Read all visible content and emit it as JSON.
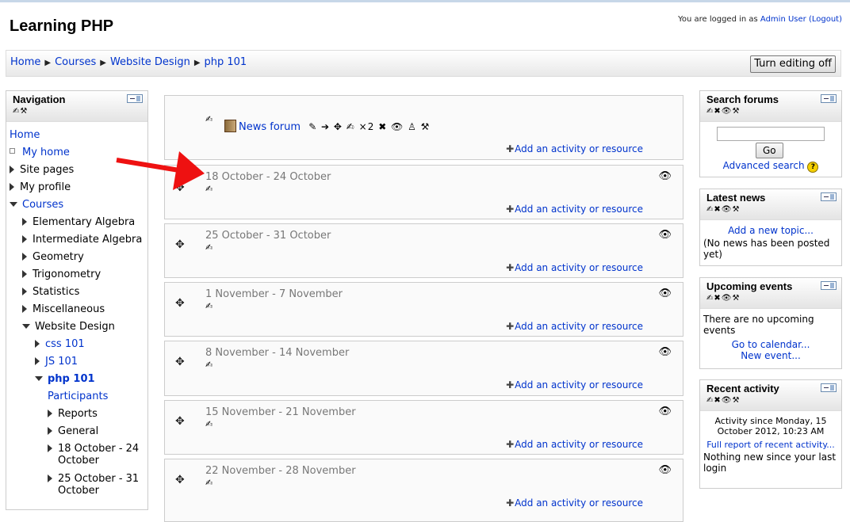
{
  "page": {
    "title": "Learning PHP"
  },
  "login": {
    "prefix": "You are logged in as",
    "user": "Admin User",
    "logout": "(Logout)"
  },
  "breadcrumb": {
    "items": [
      "Home",
      "Courses",
      "Website Design",
      "php 101"
    ],
    "separator": "▶"
  },
  "edit_button": {
    "label": "Turn editing off"
  },
  "navigation": {
    "title": "Navigation",
    "items": [
      {
        "label": "Home",
        "expander": "none"
      },
      {
        "label": "My home",
        "expander": "leaf"
      },
      {
        "label": "Site pages",
        "expander": "collapsed"
      },
      {
        "label": "My profile",
        "expander": "collapsed"
      },
      {
        "label": "Courses",
        "expander": "expanded"
      },
      {
        "label": "Elementary Algebra",
        "expander": "collapsed"
      },
      {
        "label": "Intermediate Algebra",
        "expander": "collapsed"
      },
      {
        "label": "Geometry",
        "expander": "collapsed"
      },
      {
        "label": "Trigonometry",
        "expander": "collapsed"
      },
      {
        "label": "Statistics",
        "expander": "collapsed"
      },
      {
        "label": "Miscellaneous",
        "expander": "collapsed"
      },
      {
        "label": "Website Design",
        "expander": "expanded"
      },
      {
        "label": "css 101",
        "expander": "collapsed"
      },
      {
        "label": "JS 101",
        "expander": "collapsed"
      },
      {
        "label": "php 101",
        "expander": "expanded"
      },
      {
        "label": "Participants",
        "expander": "none"
      },
      {
        "label": "Reports",
        "expander": "collapsed"
      },
      {
        "label": "General",
        "expander": "collapsed"
      },
      {
        "label": "18 October - 24",
        "label2": "October",
        "expander": "collapsed"
      },
      {
        "label": "25 October - 31",
        "label2": "October",
        "expander": "collapsed"
      }
    ]
  },
  "sections": {
    "top": {
      "forum_label": "News forum",
      "groupmode": "×2",
      "add_label": "Add an activity or resource"
    },
    "weeks": [
      {
        "title": "18 October - 24 October",
        "add_label": "Add an activity or resource"
      },
      {
        "title": "25 October - 31 October",
        "add_label": "Add an activity or resource"
      },
      {
        "title": "1 November - 7 November",
        "add_label": "Add an activity or resource"
      },
      {
        "title": "8 November - 14 November",
        "add_label": "Add an activity or resource"
      },
      {
        "title": "15 November - 21 November",
        "add_label": "Add an activity or resource"
      },
      {
        "title": "22 November - 28 November",
        "add_label": "Add an activity or resource"
      }
    ]
  },
  "search_forums": {
    "title": "Search forums",
    "input_value": "",
    "go": "Go",
    "advanced": "Advanced search"
  },
  "latest_news": {
    "title": "Latest news",
    "add_topic": "Add a new topic...",
    "empty": "(No news has been posted yet)"
  },
  "upcoming": {
    "title": "Upcoming events",
    "empty": "There are no upcoming events",
    "calendar": "Go to calendar...",
    "new_event": "New event..."
  },
  "recent": {
    "title": "Recent activity",
    "since": "Activity since Monday, 15 October 2012, 10:23 AM",
    "full_report": "Full report of recent activity...",
    "nothing": "Nothing new since your last login"
  },
  "colors": {
    "link": "#0033cc",
    "arrow": "#ee1111",
    "section_title": "#777777"
  },
  "icons": {
    "edit": "pencil-icon",
    "move": "move-icon",
    "hide": "eye-icon",
    "delete": "delete-icon",
    "help": "help-icon"
  }
}
